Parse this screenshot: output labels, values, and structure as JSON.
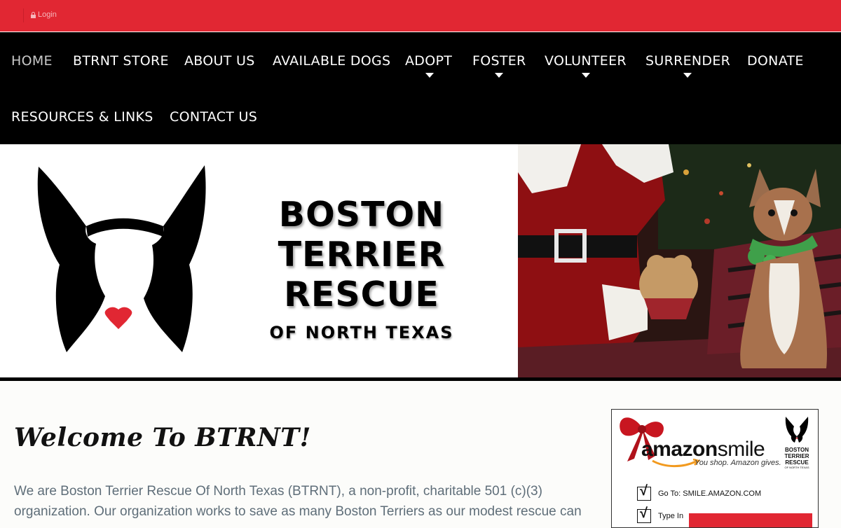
{
  "topbar": {
    "login_label": "Login",
    "lock_icon": "lock-icon"
  },
  "nav": {
    "items": [
      {
        "label": "HOME",
        "active": true
      },
      {
        "label": "BTRNT STORE"
      },
      {
        "label": "ABOUT US"
      },
      {
        "label": "AVAILABLE DOGS"
      },
      {
        "label": "ADOPT",
        "dropdown": true
      },
      {
        "label": "FOSTER",
        "dropdown": true
      },
      {
        "label": "VOLUNTEER",
        "dropdown": true
      },
      {
        "label": "SURRENDER",
        "dropdown": true
      },
      {
        "label": "DONATE"
      },
      {
        "label": "RESOURCES & LINKS"
      },
      {
        "label": "CONTACT US"
      }
    ]
  },
  "banner": {
    "line1": "BOSTON",
    "line2": "TERRIER",
    "line3": "RESCUE",
    "line4": "OF NORTH TEXAS"
  },
  "main": {
    "welcome": "Welcome To BTRNT!",
    "intro": "We are Boston Terrier Rescue Of North Texas (BTRNT), a non-profit, charitable 501 (c)(3) organization.  Our organization works to save as many Boston Terriers as our modest rescue can"
  },
  "ad": {
    "amazon": "amazon",
    "smile": "smile",
    "tagline": "You shop. Amazon gives.",
    "mini_line1": "BOSTON",
    "mini_line2": "TERRIER",
    "mini_line3": "RESCUE",
    "mini_line4": "OF NORTH TEXAS",
    "step1": "Go To:  SMILE.AMAZON.COM",
    "step2": "Type In"
  },
  "colors": {
    "accent": "#e12733",
    "nav_bg": "#000000",
    "text_muted": "#5f6e79"
  }
}
